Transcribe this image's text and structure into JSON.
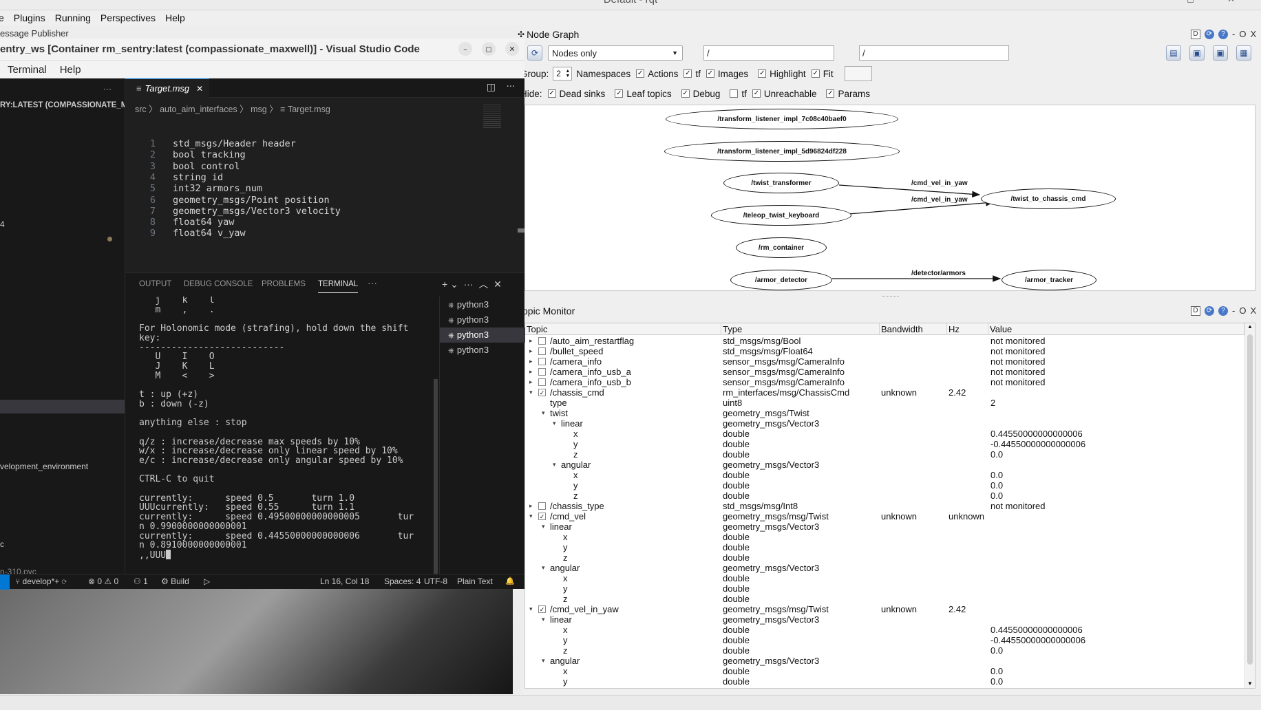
{
  "rqt": {
    "title": "Default - rqt",
    "window_controls": "– ◻ ✕",
    "menu": [
      "e",
      "Plugins",
      "Running",
      "Perspectives",
      "Help"
    ],
    "msg_publisher_label": "essage Publisher",
    "dock_controls": {
      "d": "D",
      "o": "O",
      "x": "X",
      "dash": "-"
    }
  },
  "node_graph": {
    "title": "Node Graph",
    "mode": "Nodes only",
    "filter1": "/",
    "filter2": "/",
    "group_label": "Group:",
    "group_value": "2",
    "options": [
      "Namespaces",
      "Actions",
      "tf",
      "Images",
      "Highlight",
      "Fit"
    ],
    "hide_label": "Hide:",
    "hide_options": [
      "Dead sinks",
      "Leaf topics",
      "Debug",
      "tf",
      "Unreachable",
      "Params"
    ],
    "nodes": {
      "n1": "/transform_listener_impl_7c08c40baef0",
      "n2": "/transform_listener_impl_5d96824df228",
      "n3": "/twist_transformer",
      "n4": "/teleop_twist_keyboard",
      "n5": "/rm_container",
      "n6": "/armor_detector",
      "n7": "/twist_to_chassis_cmd",
      "n8": "/armor_tracker"
    },
    "edges": {
      "e1": "/cmd_vel_in_yaw",
      "e2": "/cmd_vel_in_yaw",
      "e3": "/detector/armors"
    }
  },
  "topic_monitor": {
    "title": "Topic Monitor",
    "headers": {
      "topic": "Topic",
      "type": "Type",
      "bandwidth": "Bandwidth",
      "hz": "Hz",
      "value": "Value"
    },
    "rows": [
      {
        "arrow": "▸",
        "cb": "",
        "topic": "/auto_aim_restartflag",
        "type": "std_msgs/msg/Bool",
        "bw": "",
        "hz": "",
        "value": "not monitored"
      },
      {
        "arrow": "▸",
        "cb": "",
        "topic": "/bullet_speed",
        "type": "std_msgs/msg/Float64",
        "bw": "",
        "hz": "",
        "value": "not monitored"
      },
      {
        "arrow": "▸",
        "cb": "",
        "topic": "/camera_info",
        "type": "sensor_msgs/msg/CameraInfo",
        "bw": "",
        "hz": "",
        "value": "not monitored"
      },
      {
        "arrow": "▸",
        "cb": "",
        "topic": "/camera_info_usb_a",
        "type": "sensor_msgs/msg/CameraInfo",
        "bw": "",
        "hz": "",
        "value": "not monitored"
      },
      {
        "arrow": "▸",
        "cb": "",
        "topic": "/camera_info_usb_b",
        "type": "sensor_msgs/msg/CameraInfo",
        "bw": "",
        "hz": "",
        "value": "not monitored"
      },
      {
        "arrow": "▾",
        "cb": "✓",
        "topic": "/chassis_cmd",
        "type": "rm_interfaces/msg/ChassisCmd",
        "bw": "unknown",
        "hz": "2.42",
        "value": ""
      },
      {
        "topic": "type",
        "type": "uint8",
        "value": "2"
      },
      {
        "arrow": "▾",
        "topic": "twist",
        "type": "geometry_msgs/Twist",
        "value": ""
      },
      {
        "arrow": "▾",
        "topic": "linear",
        "type": "geometry_msgs/Vector3",
        "value": ""
      },
      {
        "topic": "x",
        "type": "double",
        "value": "0.44550000000000006"
      },
      {
        "topic": "y",
        "type": "double",
        "value": "-0.44550000000000006"
      },
      {
        "topic": "z",
        "type": "double",
        "value": "0.0"
      },
      {
        "arrow": "▾",
        "topic": "angular",
        "type": "geometry_msgs/Vector3",
        "value": ""
      },
      {
        "topic": "x",
        "type": "double",
        "value": "0.0"
      },
      {
        "topic": "y",
        "type": "double",
        "value": "0.0"
      },
      {
        "topic": "z",
        "type": "double",
        "value": "0.0"
      },
      {
        "arrow": "▸",
        "cb": "",
        "topic": "/chassis_type",
        "type": "std_msgs/msg/Int8",
        "bw": "",
        "hz": "",
        "value": "not monitored"
      },
      {
        "arrow": "▾",
        "cb": "✓",
        "topic": "/cmd_vel",
        "type": "geometry_msgs/msg/Twist",
        "bw": "unknown",
        "hz": "unknown",
        "value": ""
      },
      {
        "arrow": "▾",
        "topic": "linear",
        "type": "geometry_msgs/Vector3",
        "value": ""
      },
      {
        "topic": "x",
        "type": "double",
        "value": ""
      },
      {
        "topic": "y",
        "type": "double",
        "value": ""
      },
      {
        "topic": "z",
        "type": "double",
        "value": ""
      },
      {
        "arrow": "▾",
        "topic": "angular",
        "type": "geometry_msgs/Vector3",
        "value": ""
      },
      {
        "topic": "x",
        "type": "double",
        "value": ""
      },
      {
        "topic": "y",
        "type": "double",
        "value": ""
      },
      {
        "topic": "z",
        "type": "double",
        "value": ""
      },
      {
        "arrow": "▾",
        "cb": "✓",
        "topic": "/cmd_vel_in_yaw",
        "type": "geometry_msgs/msg/Twist",
        "bw": "unknown",
        "hz": "2.42",
        "value": ""
      },
      {
        "arrow": "▾",
        "topic": "linear",
        "type": "geometry_msgs/Vector3",
        "value": ""
      },
      {
        "topic": "x",
        "type": "double",
        "value": "0.44550000000000006"
      },
      {
        "topic": "y",
        "type": "double",
        "value": "-0.44550000000000006"
      },
      {
        "topic": "z",
        "type": "double",
        "value": "0.0"
      },
      {
        "arrow": "▾",
        "topic": "angular",
        "type": "geometry_msgs/Vector3",
        "value": ""
      },
      {
        "topic": "x",
        "type": "double",
        "value": "0.0"
      },
      {
        "topic": "y",
        "type": "double",
        "value": "0.0"
      }
    ]
  },
  "vscode": {
    "title": "entry_ws [Container rm_sentry:latest (compassionate_maxwell)] - Visual Studio Code",
    "menu": [
      "Terminal",
      "Help"
    ],
    "window_buttons": {
      "min": "–",
      "max": "◻",
      "close": "✕"
    },
    "sidebar": {
      "more": "···",
      "header": "RY:LATEST (COMPASSIONATE_M...",
      "item_4": "4",
      "item_dev": "velopment_environment",
      "item_c": "c",
      "item_pyc": "n-310.pyc"
    },
    "tab": {
      "label": "Target.msg",
      "close": "✕"
    },
    "editor_actions": {
      "split": "◫",
      "more": "···"
    },
    "breadcrumb": "src 〉 auto_aim_interfaces 〉 msg 〉 ≡ Target.msg",
    "code": [
      {
        "n": "1",
        "text": "std_msgs/Header header"
      },
      {
        "n": "2",
        "text": "bool tracking"
      },
      {
        "n": "3",
        "text": "bool control"
      },
      {
        "n": "4",
        "text": "string id"
      },
      {
        "n": "5",
        "text": "int32 armors_num"
      },
      {
        "n": "6",
        "text": "geometry_msgs/Point position"
      },
      {
        "n": "7",
        "text": "geometry_msgs/Vector3 velocity"
      },
      {
        "n": "8",
        "text": "float64 yaw"
      },
      {
        "n": "9",
        "text": "float64 v_yaw"
      }
    ],
    "panel_tabs": [
      "OUTPUT",
      "DEBUG CONSOLE",
      "PROBLEMS",
      "TERMINAL",
      "···"
    ],
    "panel_actions": "+ ⌄  ···  ︿  ✕",
    "terminal_lines": [
      "   j    k    l",
      "   m    ,    .",
      "",
      "For Holonomic mode (strafing), hold down the shift",
      "key:",
      "---------------------------",
      "   U    I    O",
      "   J    K    L",
      "   M    <    >",
      "",
      "t : up (+z)",
      "b : down (-z)",
      "",
      "anything else : stop",
      "",
      "q/z : increase/decrease max speeds by 10%",
      "w/x : increase/decrease only linear speed by 10%",
      "e/c : increase/decrease only angular speed by 10%",
      "",
      "CTRL-C to quit",
      "",
      "currently:      speed 0.5       turn 1.0",
      "UUUcurrently:   speed 0.55      turn 1.1",
      "currently:      speed 0.49500000000000005       tur",
      "n 0.9900000000000001",
      "currently:      speed 0.44550000000000006       tur",
      "n 0.8910000000000001",
      ",,UUU"
    ],
    "terminals": [
      "python3",
      "python3",
      "python3",
      "python3"
    ],
    "status": {
      "branch": "⑂ develop*+ ⟳",
      "problems": "⊗ 0 ⚠ 0",
      "ports": "⚇ 1",
      "build": "⚙ Build",
      "run": "▷",
      "position": "Ln 16, Col 18",
      "spaces": "Spaces: 4",
      "encoding": "UTF-8",
      "language": "Plain Text",
      "bell": "🔔"
    }
  }
}
